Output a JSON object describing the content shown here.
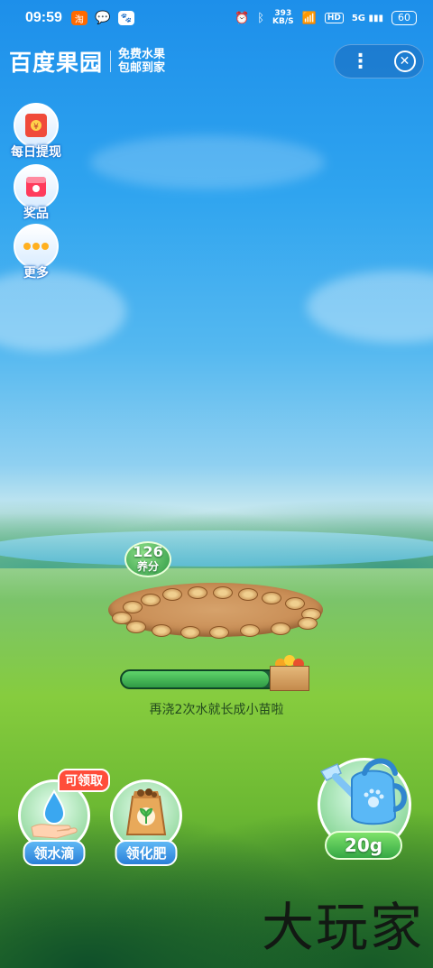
{
  "status_bar": {
    "time": "09:59",
    "net_speed_value": "393",
    "net_speed_unit": "KB/S",
    "hd": "HD",
    "signal": "5G",
    "battery": "60"
  },
  "header": {
    "brand": "百度果园",
    "slogan_line1": "免费水果",
    "slogan_line2": "包邮到家",
    "more": "⋮",
    "close": "✕"
  },
  "sidebar": {
    "items": [
      {
        "label": "每日提现"
      },
      {
        "label": "奖品"
      },
      {
        "label": "更多"
      }
    ]
  },
  "farm": {
    "score_value": "126",
    "score_unit": "养分",
    "progress_text": "再浇2次水就长成小苗啦",
    "progress": 0.9
  },
  "actions": {
    "badge": "可领取",
    "water_drop": "领水滴",
    "fertilizer": "领化肥",
    "water_amount": "20g"
  },
  "watermark": "大玩家"
}
